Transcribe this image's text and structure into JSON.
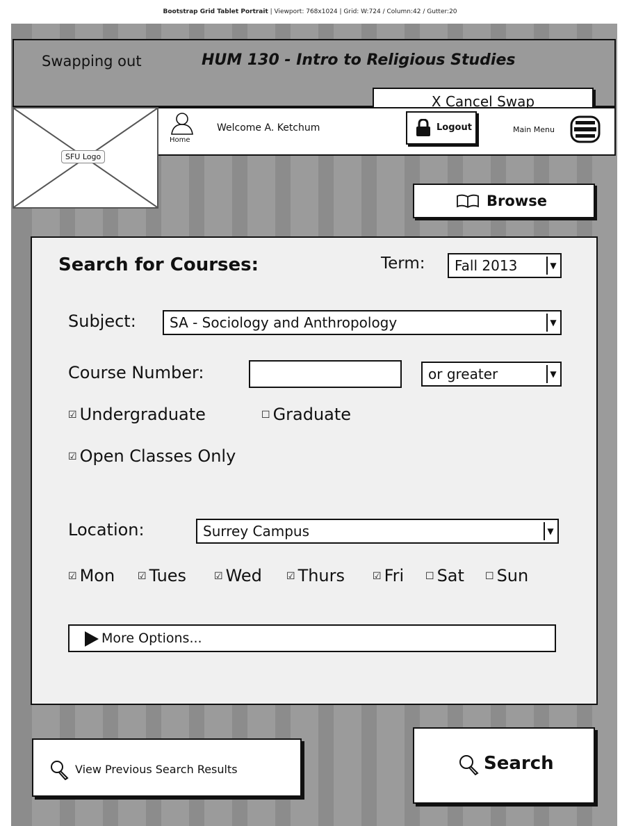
{
  "grid_caption": {
    "title": "Bootstrap Grid Tablet Portrait",
    "details": " | Viewport: 768x1024 | Grid: W:724 / Column:42 / Gutter:20"
  },
  "swap": {
    "label": "Swapping out",
    "course": "HUM 130 - Intro to Religious Studies",
    "cancel_label": "X Cancel Swap"
  },
  "header": {
    "logo_label": "SFU Logo",
    "home_label": "Home",
    "welcome": "Welcome A. Ketchum",
    "logout_label": "Logout",
    "main_menu_label": "Main Menu",
    "icons": {
      "user": "user-icon",
      "lock": "lock-icon",
      "menu": "menu-icon"
    }
  },
  "browse": {
    "label": "Browse",
    "icon": "book-icon"
  },
  "search_form": {
    "title": "Search for Courses:",
    "term_label": "Term:",
    "term_value": "Fall 2013",
    "subject_label": "Subject:",
    "subject_value": "SA - Sociology and Anthropology",
    "course_number_label": "Course Number:",
    "course_number_value": "",
    "course_number_qualifier": "or greater",
    "undergraduate": {
      "label": "Undergraduate",
      "checked": true
    },
    "graduate": {
      "label": "Graduate",
      "checked": false
    },
    "open_classes": {
      "label": "Open Classes Only",
      "checked": true
    },
    "location_label": "Location:",
    "location_value": "Surrey Campus",
    "days": [
      {
        "label": "Mon",
        "checked": true
      },
      {
        "label": "Tues",
        "checked": true
      },
      {
        "label": "Wed",
        "checked": true
      },
      {
        "label": "Thurs",
        "checked": true
      },
      {
        "label": "Fri",
        "checked": true
      },
      {
        "label": "Sat",
        "checked": false
      },
      {
        "label": "Sun",
        "checked": false
      }
    ],
    "more_options_label": "More Options..."
  },
  "actions": {
    "previous_results_label": "View Previous Search Results",
    "search_label": "Search",
    "icons": {
      "search": "search-icon"
    }
  },
  "glyphs": {
    "checked": "☑",
    "unchecked": "☐",
    "dropdown": "▼"
  },
  "colors": {
    "background": "#8c8c8c",
    "column": "#9b9b9b",
    "panel": "#f0f0f0",
    "ink": "#111111"
  }
}
